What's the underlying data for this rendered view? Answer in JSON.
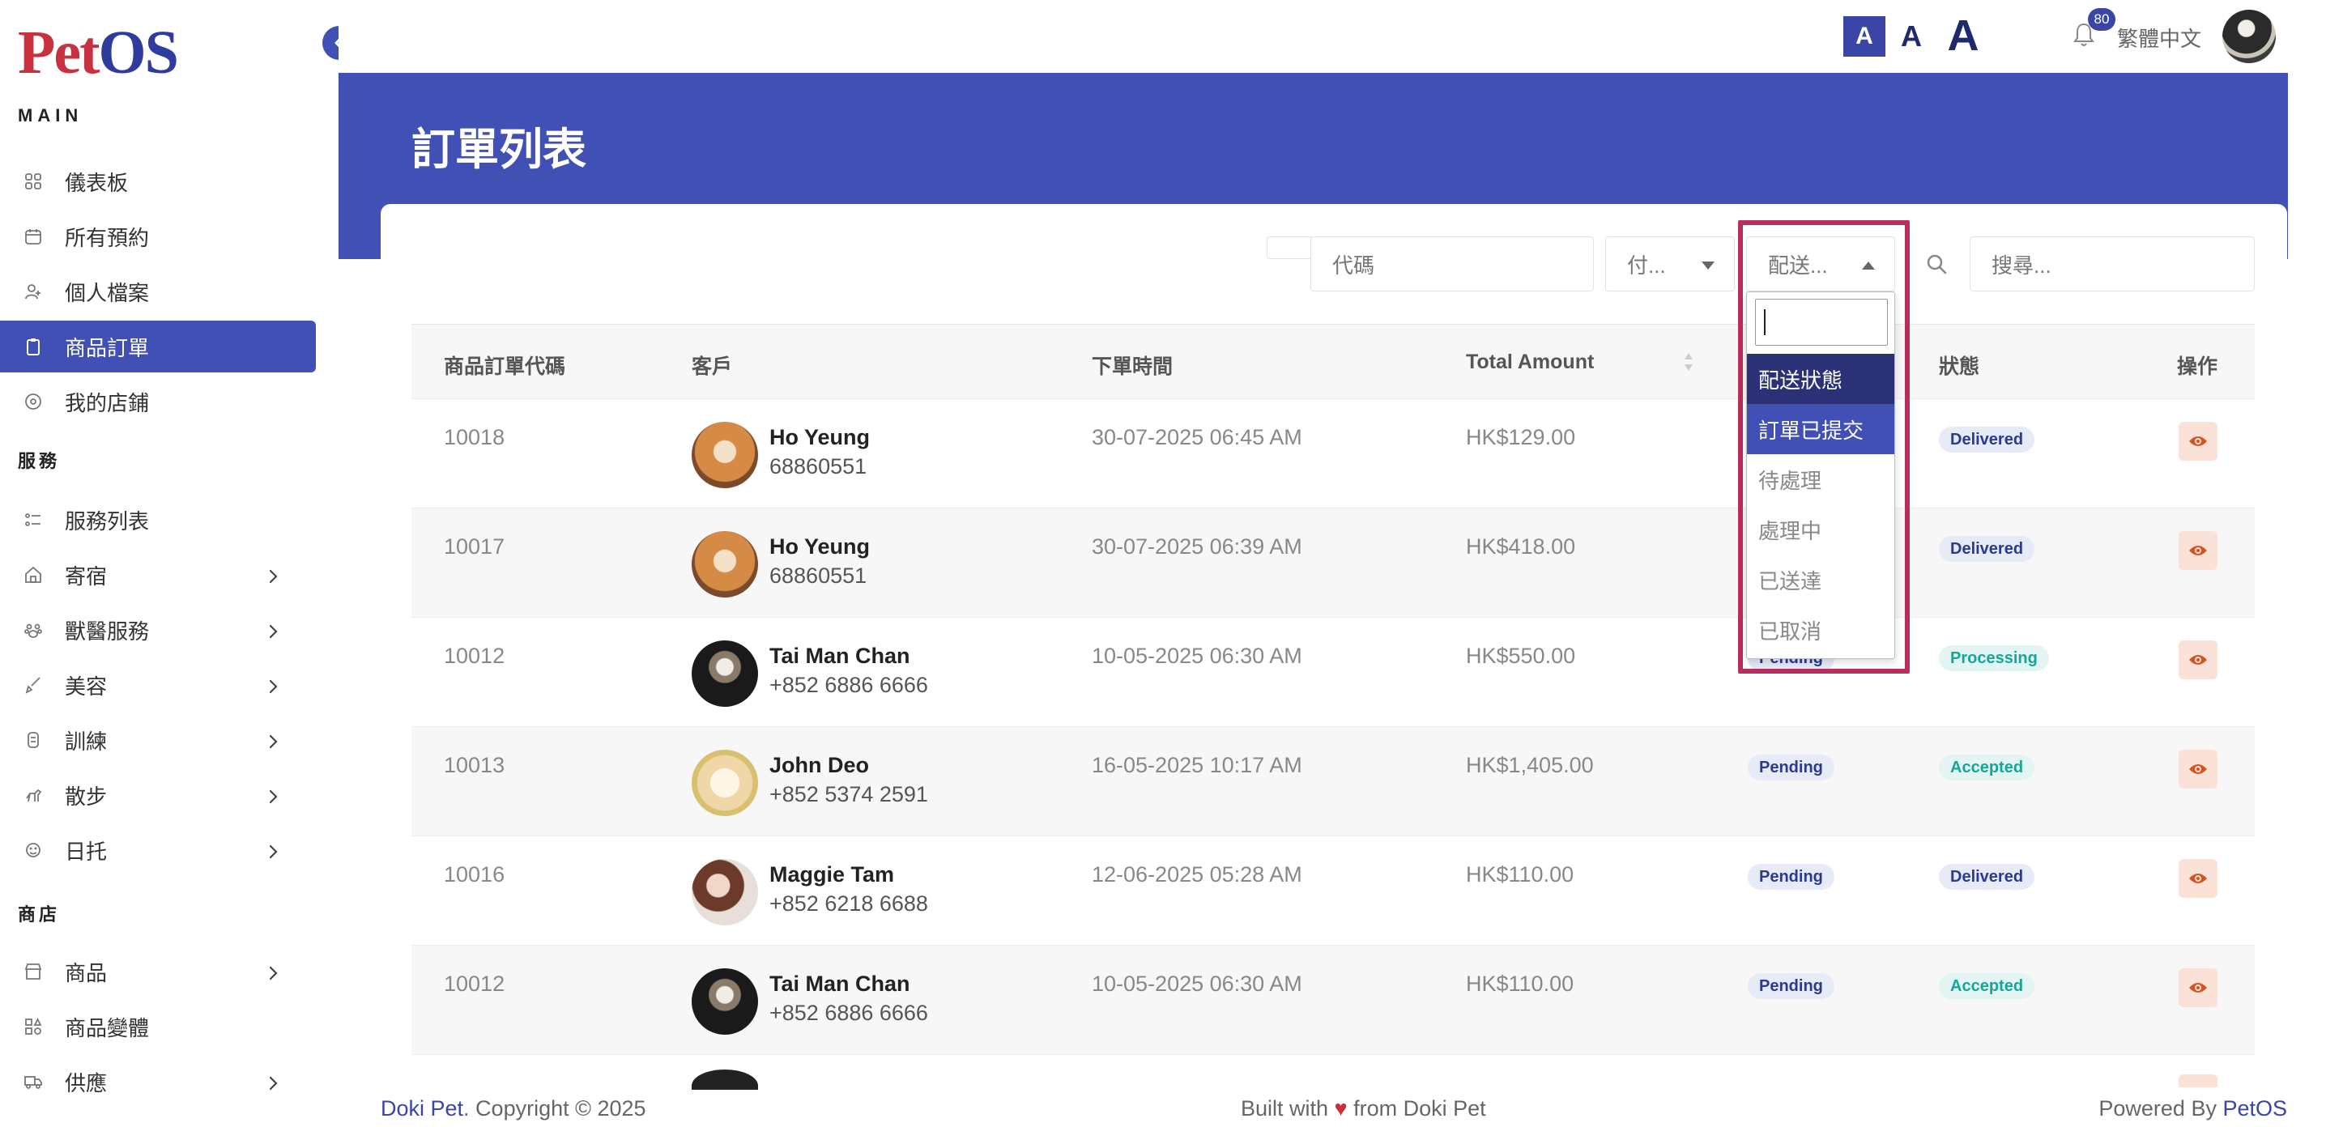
{
  "app": {
    "logo_pet": "Pet",
    "logo_os": "OS"
  },
  "sidebar": {
    "section_main": "MAIN",
    "section_services": "服務",
    "section_shop": "商店",
    "items": [
      {
        "label": "儀表板",
        "icon": "grid-icon",
        "chevron": false,
        "active": false
      },
      {
        "label": "所有預約",
        "icon": "calendar-icon",
        "chevron": false,
        "active": false
      },
      {
        "label": "個人檔案",
        "icon": "user-icon",
        "chevron": false,
        "active": false
      },
      {
        "label": "商品訂單",
        "icon": "clipboard-icon",
        "chevron": false,
        "active": true
      },
      {
        "label": "我的店鋪",
        "icon": "store-icon",
        "chevron": false,
        "active": false
      },
      {
        "label": "服務列表",
        "icon": "list-icon",
        "chevron": false,
        "active": false
      },
      {
        "label": "寄宿",
        "icon": "house-icon",
        "chevron": true,
        "active": false
      },
      {
        "label": "獸醫服務",
        "icon": "vet-icon",
        "chevron": true,
        "active": false
      },
      {
        "label": "美容",
        "icon": "brush-icon",
        "chevron": true,
        "active": false
      },
      {
        "label": "訓練",
        "icon": "training-icon",
        "chevron": true,
        "active": false
      },
      {
        "label": "散步",
        "icon": "walk-icon",
        "chevron": true,
        "active": false
      },
      {
        "label": "日托",
        "icon": "daycare-icon",
        "chevron": true,
        "active": false
      },
      {
        "label": "商品",
        "icon": "shop-icon",
        "chevron": true,
        "active": false
      },
      {
        "label": "商品變體",
        "icon": "variants-icon",
        "chevron": false,
        "active": false
      },
      {
        "label": "供應",
        "icon": "truck-icon",
        "chevron": true,
        "active": false
      }
    ]
  },
  "header": {
    "font_small": "A",
    "font_mid": "A",
    "font_big": "A",
    "notifications": "80",
    "language": "繁體中文"
  },
  "page": {
    "title": "訂單列表"
  },
  "filters": {
    "code_placeholder": "代碼",
    "payment_label": "付...",
    "delivery_label": "配送...",
    "search_placeholder": "搜尋..."
  },
  "dropdown": {
    "options": [
      "配送狀態",
      "訂單已提交",
      "待處理",
      "處理中",
      "已送達",
      "已取消"
    ]
  },
  "table": {
    "headers": [
      "商品訂單代碼",
      "客戶",
      "下單時間",
      "Total Amount",
      "狀態",
      "操作"
    ],
    "rows": [
      {
        "code": "10018",
        "name": "Ho Yeung",
        "phone": "68860551",
        "time": "30-07-2025 06:45 AM",
        "amount": "HK$129.00",
        "pay": "",
        "status": "Delivered",
        "status_kind": "delivered",
        "avatar": "shiba"
      },
      {
        "code": "10017",
        "name": "Ho Yeung",
        "phone": "68860551",
        "time": "30-07-2025 06:39 AM",
        "amount": "HK$418.00",
        "pay": "",
        "status": "Delivered",
        "status_kind": "delivered",
        "avatar": "shiba"
      },
      {
        "code": "10012",
        "name": "Tai Man Chan",
        "phone": "+852 6886 6666",
        "time": "10-05-2025 06:30 AM",
        "amount": "HK$550.00",
        "pay": "Pending",
        "status": "Processing",
        "status_kind": "processing",
        "avatar": "dark"
      },
      {
        "code": "10013",
        "name": "John Deo",
        "phone": "+852 5374 2591",
        "time": "16-05-2025 10:17 AM",
        "amount": "HK$1,405.00",
        "pay": "Pending",
        "status": "Accepted",
        "status_kind": "accepted",
        "avatar": "pom"
      },
      {
        "code": "10016",
        "name": "Maggie Tam",
        "phone": "+852 6218 6688",
        "time": "12-06-2025 05:28 AM",
        "amount": "HK$110.00",
        "pay": "Pending",
        "status": "Delivered",
        "status_kind": "delivered",
        "avatar": "woman"
      },
      {
        "code": "10012",
        "name": "Tai Man Chan",
        "phone": "+852 6886 6666",
        "time": "10-05-2025 06:30 AM",
        "amount": "HK$110.00",
        "pay": "Pending",
        "status": "Accepted",
        "status_kind": "accepted",
        "avatar": "dark"
      }
    ]
  },
  "footer": {
    "left_brand": "Doki Pet",
    "left_text": ". Copyright © 2025",
    "center_pre": "Built with ",
    "center_heart": "♥",
    "center_post": " from Doki Pet",
    "right_pre": "Powered By ",
    "right_brand": "PetOS"
  },
  "colors": {
    "primary": "#4150b5",
    "logo_red": "#c8313f",
    "highlight": "#b82d5e"
  }
}
